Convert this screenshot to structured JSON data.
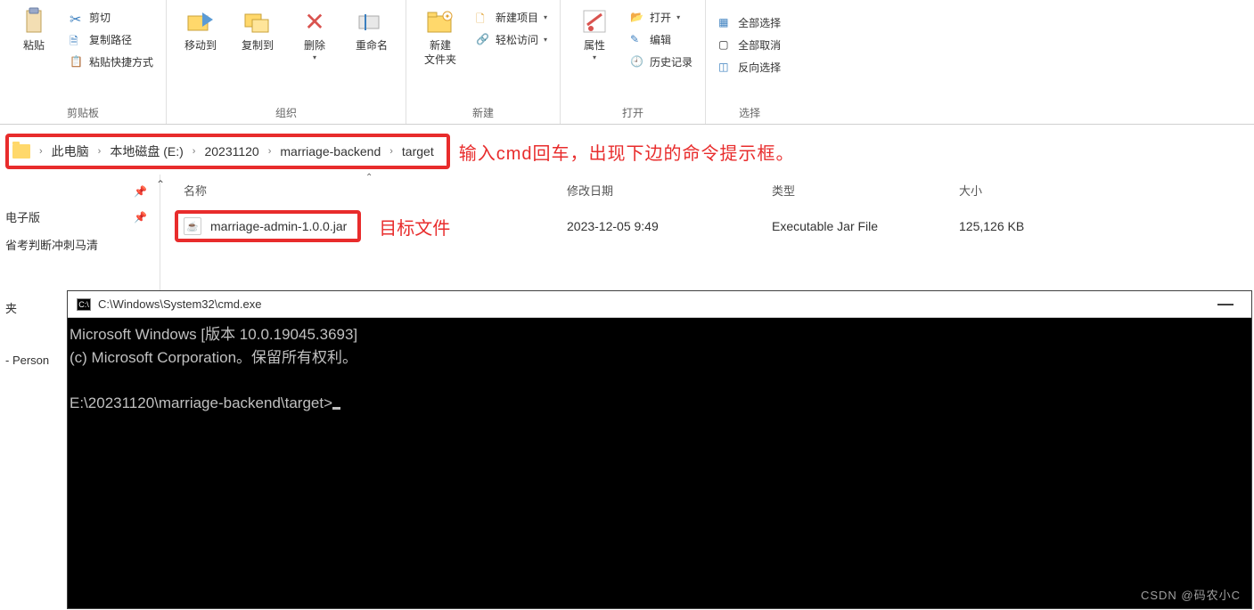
{
  "ribbon": {
    "clipboard": {
      "label": "剪贴板",
      "paste": "粘贴",
      "cut": "剪切",
      "copy_path": "复制路径",
      "paste_shortcut": "粘贴快捷方式"
    },
    "organize": {
      "label": "组织",
      "move_to": "移动到",
      "copy_to": "复制到",
      "delete": "删除",
      "rename": "重命名"
    },
    "new": {
      "label": "新建",
      "new_folder": "新建\n文件夹",
      "new_item": "新建项目",
      "easy_access": "轻松访问"
    },
    "open": {
      "label": "打开",
      "properties": "属性",
      "open": "打开",
      "edit": "编辑",
      "history": "历史记录"
    },
    "select": {
      "label": "选择",
      "select_all": "全部选择",
      "select_none": "全部取消",
      "invert": "反向选择"
    }
  },
  "breadcrumb": {
    "items": [
      "此电脑",
      "本地磁盘 (E:)",
      "20231120",
      "marriage-backend",
      "target"
    ]
  },
  "annotations": {
    "addr": "输入cmd回车，出现下边的命令提示框。",
    "targetfile": "目标文件"
  },
  "nav": {
    "item0": "电子版",
    "item1": "省考判断冲刺马清",
    "item2": "夹",
    "item3": " - Person"
  },
  "columns": {
    "name": "名称",
    "date": "修改日期",
    "type": "类型",
    "size": "大小"
  },
  "files": [
    {
      "name": "marriage-admin-1.0.0.jar",
      "date": "2023-12-05 9:49",
      "type": "Executable Jar File",
      "size": "125,126 KB"
    }
  ],
  "cmd": {
    "title": "C:\\Windows\\System32\\cmd.exe",
    "line1": "Microsoft Windows [版本 10.0.19045.3693]",
    "line2": "(c) Microsoft Corporation。保留所有权利。",
    "prompt": "E:\\20231120\\marriage-backend\\target>"
  },
  "watermark": "CSDN @码农小C"
}
